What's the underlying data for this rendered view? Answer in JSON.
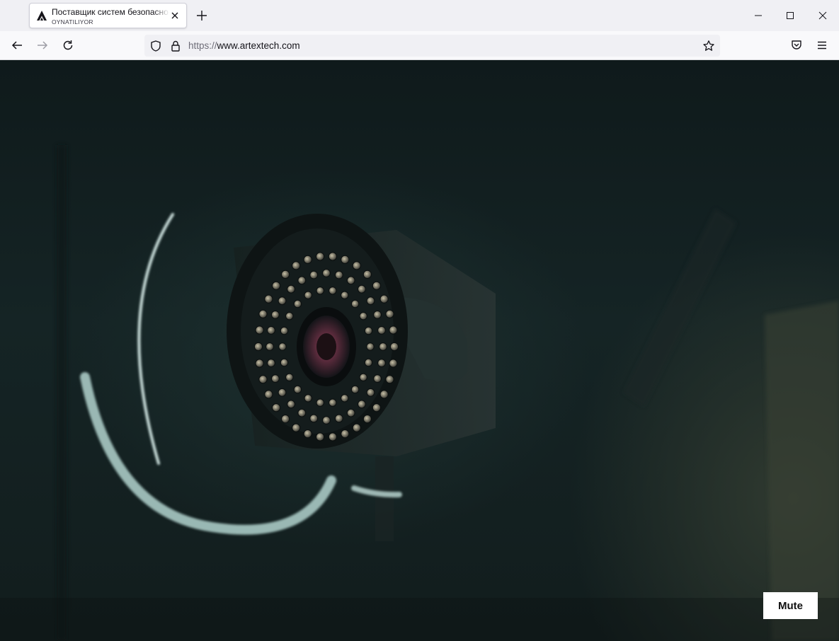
{
  "tab": {
    "title": "Поставщик систем безопасности",
    "subtitle": "OYNATILIYOR",
    "favicon": "artex-logo-icon"
  },
  "urlbar": {
    "protocol": "https://",
    "host": "www.artextech.com"
  },
  "video": {
    "mute_label": "Mute"
  },
  "colors": {
    "tab_strip_bg": "#f0f0f4",
    "toolbar_bg": "#f9f9fb",
    "video_bg": "#132122",
    "ring_accent": "#a9c9c4"
  },
  "icons": [
    "artex-logo-icon",
    "close-icon",
    "plus-icon",
    "minimize-icon",
    "maximize-icon",
    "window-close-icon",
    "back-arrow-icon",
    "forward-arrow-icon",
    "reload-icon",
    "shield-icon",
    "lock-icon",
    "star-icon",
    "pocket-icon",
    "menu-icon"
  ]
}
